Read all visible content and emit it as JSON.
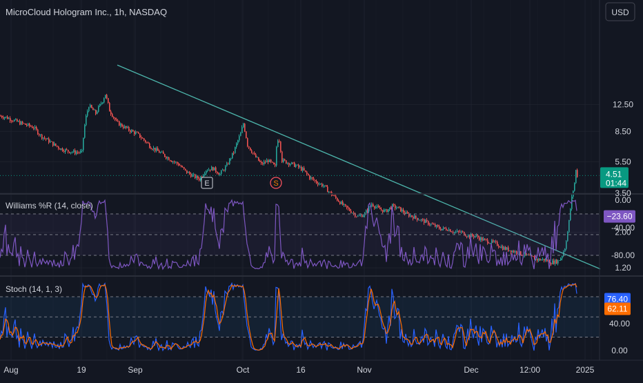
{
  "header": {
    "symbol_title": "MicroCloud Hologram Inc., 1h, NASDAQ",
    "currency_button": "USD"
  },
  "colors": {
    "background": "#131722",
    "grid": "#1e222d",
    "axis_text": "#d1d4dc",
    "candle_up": "#26a69a",
    "candle_down": "#ef5350",
    "trendline": "#4db6ac",
    "williams_line": "#7e57c2",
    "stoch_k": "#2962ff",
    "stoch_d": "#ff6d00",
    "price_badge": "#089981"
  },
  "chart_data": [
    {
      "type": "line",
      "title": "MicroCloud Hologram Inc., 1h, NASDAQ",
      "x_ticks": [
        "Aug",
        "19",
        "Sep",
        "Oct",
        "16",
        "Nov",
        "Dec",
        "12:00",
        "2025"
      ],
      "x": [
        0,
        8,
        18,
        28,
        38,
        48,
        58,
        68,
        78,
        88,
        98,
        108,
        118,
        123,
        128,
        138,
        148,
        152,
        158,
        168,
        178,
        188,
        198,
        208,
        218,
        228,
        238,
        248,
        258,
        268,
        278,
        288,
        298,
        308,
        318,
        328,
        338,
        348,
        352,
        358,
        368,
        378,
        388,
        398,
        400,
        403,
        408,
        418,
        428,
        438,
        448,
        458,
        468,
        478,
        488,
        498,
        508,
        518,
        528,
        538,
        548,
        558,
        568,
        578,
        588,
        598,
        608,
        618,
        628,
        638,
        648,
        658,
        668,
        678,
        688,
        698,
        708,
        718,
        728,
        738,
        748,
        758,
        768,
        778,
        788,
        798,
        808,
        813,
        818,
        823,
        826,
        829,
        831,
        833,
        835,
        836
      ],
      "x_unit": "px",
      "y": [
        10.6,
        10.4,
        10.0,
        9.6,
        9.3,
        9.0,
        8.0,
        7.5,
        7.0,
        6.6,
        6.4,
        6.3,
        6.3,
        10.0,
        12.3,
        11.0,
        13.2,
        14.5,
        11.5,
        9.7,
        9.1,
        8.6,
        8.2,
        7.5,
        6.8,
        6.4,
        6.0,
        5.6,
        5.3,
        4.8,
        4.5,
        4.3,
        4.9,
        5.0,
        4.6,
        5.2,
        6.3,
        8.2,
        9.5,
        7.0,
        6.0,
        5.3,
        5.6,
        5.1,
        6.8,
        8.0,
        5.6,
        5.4,
        5.2,
        4.9,
        4.4,
        4.1,
        3.9,
        3.5,
        3.2,
        2.9,
        2.7,
        2.5,
        2.6,
        3.0,
        2.8,
        2.7,
        2.9,
        2.8,
        2.6,
        2.5,
        2.4,
        2.3,
        2.2,
        2.1,
        2.1,
        2.0,
        2.0,
        1.9,
        1.9,
        1.8,
        1.75,
        1.7,
        1.6,
        1.55,
        1.5,
        1.45,
        1.4,
        1.35,
        1.35,
        1.3,
        1.32,
        1.4,
        1.6,
        2.1,
        2.8,
        3.5,
        3.8,
        4.3,
        5.4,
        4.51
      ],
      "y_unit": "USD",
      "y_ticks": [
        12.5,
        8.5,
        5.5,
        3.5,
        2.0,
        1.2
      ],
      "log_scale": true,
      "current_price": "4.51",
      "countdown": "01:44",
      "trendline": {
        "x": [
          170,
          870
        ],
        "y": [
          22.0,
          1.18
        ]
      },
      "markers": [
        "E",
        "S"
      ],
      "grid": true
    },
    {
      "type": "line",
      "title": "Williams %R (14, close)",
      "y_ticks": [
        "0.00",
        "-40.00",
        "-80.00"
      ],
      "levels": [
        -20,
        -80
      ],
      "ylim": [
        -100,
        0
      ],
      "current_value": "−23.60",
      "grid": true
    },
    {
      "type": "line",
      "title": "Stoch (14, 1, 3)",
      "y_ticks": [
        "40.00",
        "0.00"
      ],
      "levels": [
        80,
        50,
        20
      ],
      "ylim": [
        0,
        100
      ],
      "current_values": {
        "k": "76.40",
        "d": "62.11"
      },
      "grid": true
    }
  ]
}
